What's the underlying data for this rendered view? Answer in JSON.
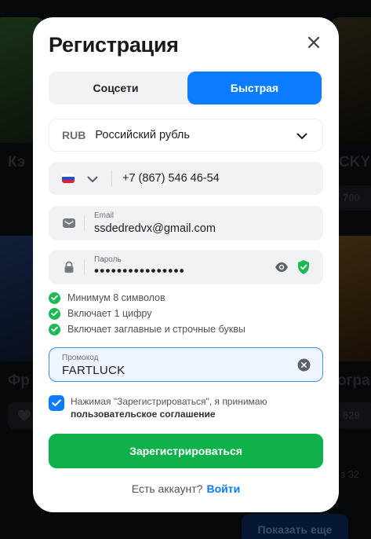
{
  "modal": {
    "title": "Регистрация",
    "tabs": [
      {
        "label": "Соцсети",
        "active": false
      },
      {
        "label": "Быстрая",
        "active": true
      }
    ],
    "currency": {
      "code": "RUB",
      "name": "Российский рубль"
    },
    "phone": {
      "value": "+7 (867) 546 46-54",
      "country_flag": "russia-flag-icon"
    },
    "email": {
      "label": "Email",
      "value": "ssdedredvx@gmail.com"
    },
    "password": {
      "label": "Пароль",
      "value": "••••••••••••••••"
    },
    "rules": [
      "Минимум 8 символов",
      "Включает 1 цифру",
      "Включает заглавные и строчные буквы"
    ],
    "promo": {
      "label": "Промокод",
      "value": "FARTLUCK"
    },
    "agreement": {
      "text": "Нажимая \"Зарегистрироваться\", я принимаю",
      "link": "пользовательское соглашение",
      "checked": true
    },
    "submit_label": "Зарегистрироваться",
    "login_prompt": "Есть аккаунт?",
    "login_link": "Войти"
  },
  "background": {
    "left_card_1": "Кэ",
    "right_card_1": "CKY",
    "left_card_2": "Фр",
    "right_card_2": "огра",
    "right_count_1": "700",
    "right_count_2": "629",
    "right_count_3": "з 32",
    "show_more": "Показать еще"
  },
  "colors": {
    "accent": "#0a7cff",
    "success": "#10b14b",
    "check": "#1db954"
  }
}
